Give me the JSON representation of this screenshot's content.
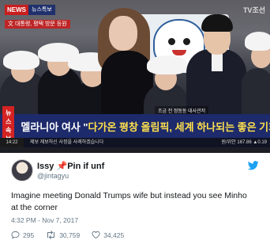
{
  "video": {
    "channel_logo": "NEWS",
    "top_bar_label": "뉴스특보",
    "top_bar_sub": "文 대통령, 평택 방문 등원",
    "tv_logo": "TV조선",
    "subcaption": "조금 전 정동동 대사관저",
    "ticker_tag": "뉴스속보",
    "headline_prefix": "멜라니아 여사 \"",
    "headline_highlight": "다가온 평창 올림픽, 세계 하나되는 좋은 기회",
    "headline_suffix": "\"",
    "ticker_time": "14:22",
    "ticker_scroll": "제보     제보하신 사정을 사례하겠습니다",
    "ticker_stock": "원/위안     167.86 ▲0.19"
  },
  "tweet": {
    "display_name": "Issy",
    "name_emoji": "📌",
    "name_suffix": "Pin if unf",
    "handle": "@jintagyu",
    "text": "Imagine meeting Donald Trumps wife but instead you see Minho at the corner",
    "timestamp": "4:32 PM - Nov 7, 2017",
    "reply_count": "295",
    "retweet_count": "30,759",
    "like_count": "34,425"
  },
  "colors": {
    "twitter_blue": "#1da1f2",
    "ticker_blue": "#1d2a6b",
    "ticker_red": "#d42222",
    "highlight_yellow": "#ffe14d",
    "like_red": "#e0245e"
  },
  "icons": [
    "twitter-bird-icon",
    "reply-icon",
    "retweet-icon",
    "like-icon"
  ]
}
